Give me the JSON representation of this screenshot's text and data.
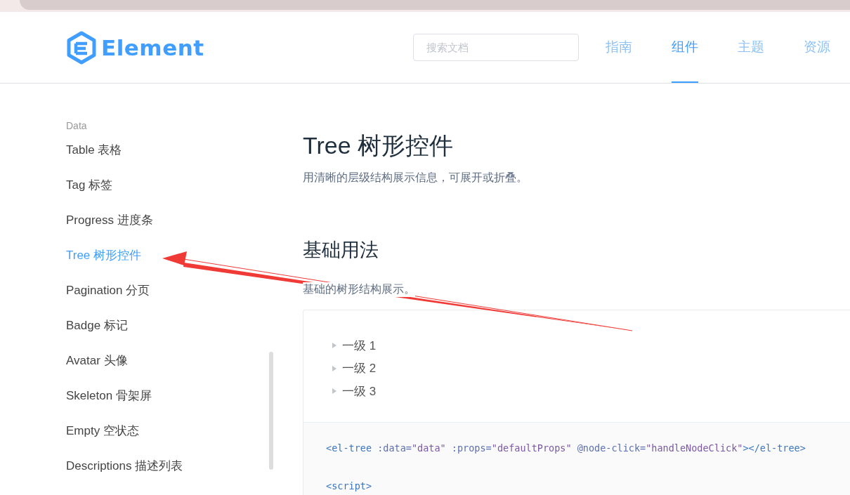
{
  "logo": {
    "text": "Element"
  },
  "search": {
    "placeholder": "搜索文档"
  },
  "nav": [
    {
      "label": "指南",
      "selected": false
    },
    {
      "label": "组件",
      "selected": true
    },
    {
      "label": "主题",
      "selected": false
    },
    {
      "label": "资源",
      "selected": false
    }
  ],
  "sidebar": {
    "groups": [
      {
        "title": "Data",
        "items": [
          {
            "label": "Table 表格",
            "selected": false
          },
          {
            "label": "Tag 标签",
            "selected": false
          },
          {
            "label": "Progress 进度条",
            "selected": false
          },
          {
            "label": "Tree 树形控件",
            "selected": true
          },
          {
            "label": "Pagination 分页",
            "selected": false
          },
          {
            "label": "Badge 标记",
            "selected": false
          },
          {
            "label": "Avatar 头像",
            "selected": false
          },
          {
            "label": "Skeleton 骨架屏",
            "selected": false
          },
          {
            "label": "Empty 空状态",
            "selected": false
          },
          {
            "label": "Descriptions 描述列表",
            "selected": false
          }
        ]
      }
    ]
  },
  "content": {
    "title": "Tree 树形控件",
    "description": "用清晰的层级结构展示信息，可展开或折叠。",
    "section_title": "基础用法",
    "section_description": "基础的树形结构展示。",
    "tree": [
      {
        "label": "一级 1",
        "expanded": false
      },
      {
        "label": "一级 2",
        "expanded": false
      },
      {
        "label": "一级 3",
        "expanded": false
      }
    ],
    "code": [
      [
        {
          "text": "<el-tree",
          "kind": "tag"
        },
        {
          "text": " :data=",
          "kind": "attr"
        },
        {
          "text": "\"data\"",
          "kind": "string"
        },
        {
          "text": " :props=",
          "kind": "attr"
        },
        {
          "text": "\"defaultProps\"",
          "kind": "string"
        },
        {
          "text": " @node-click=",
          "kind": "attr"
        },
        {
          "text": "\"handleNodeClick\"",
          "kind": "string"
        },
        {
          "text": "></el-tree>",
          "kind": "tag"
        }
      ],
      [
        {
          "text": "<script>",
          "kind": "tag"
        }
      ]
    ]
  }
}
